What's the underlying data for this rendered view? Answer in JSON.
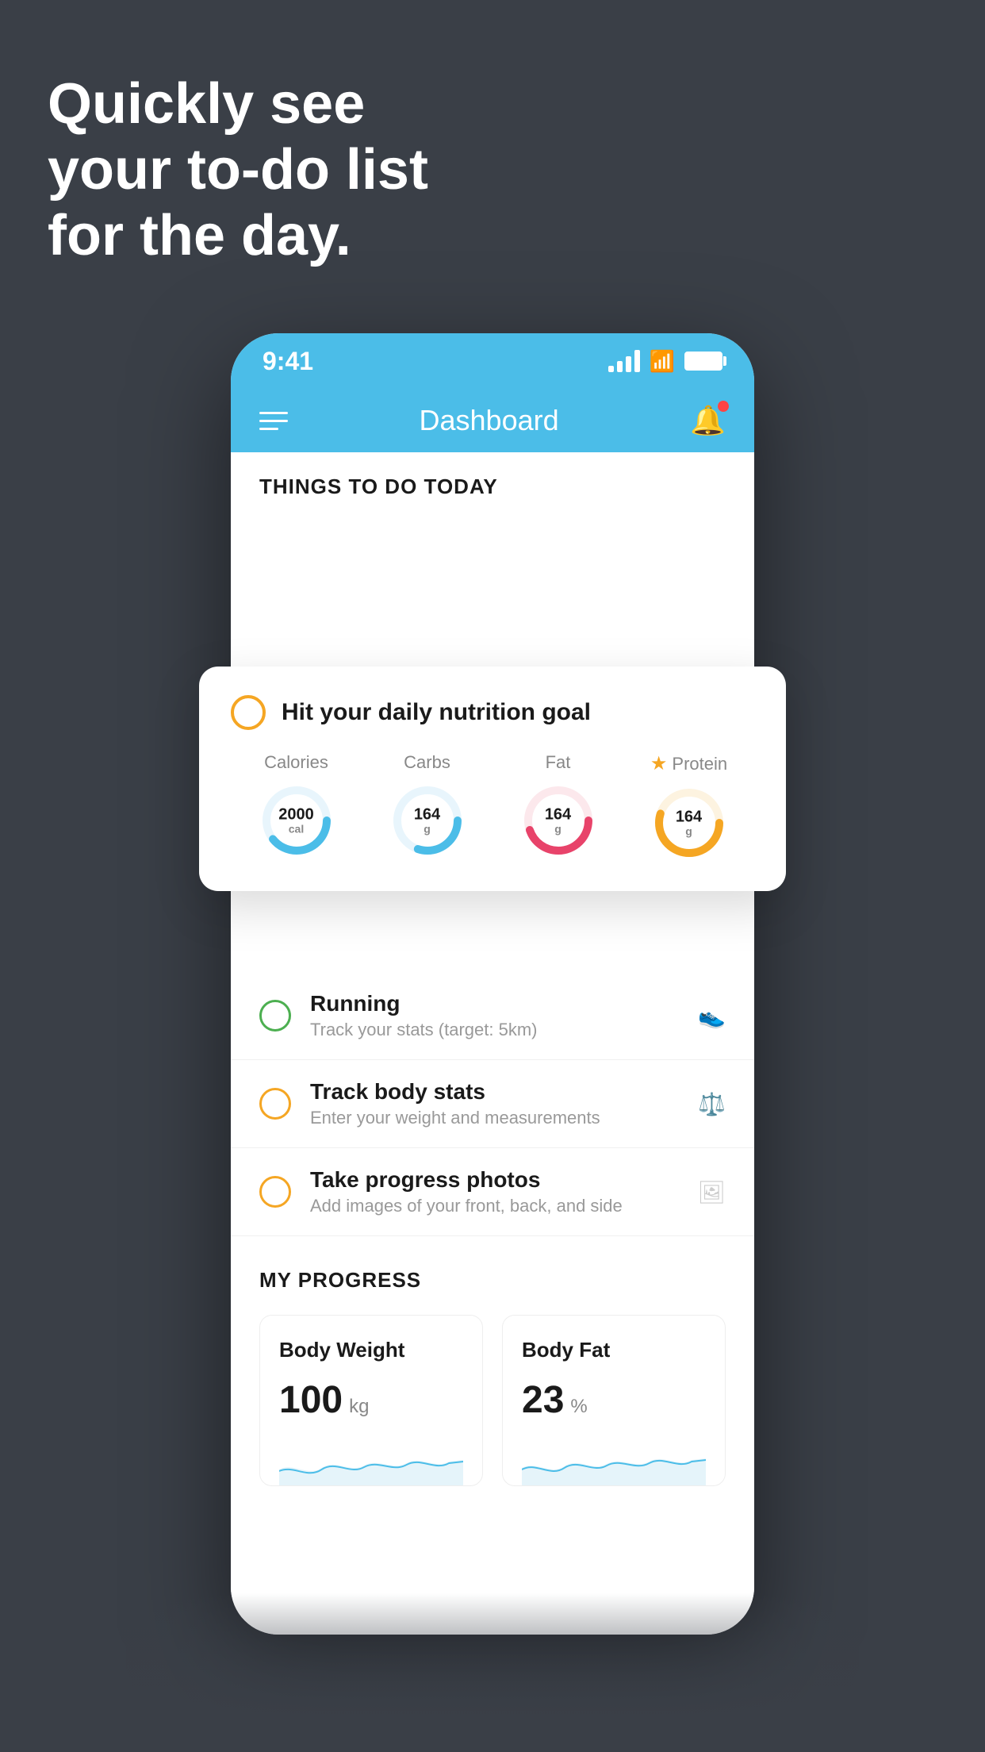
{
  "background": {
    "color": "#3a3f47"
  },
  "hero": {
    "line1": "Quickly see",
    "line2": "your to-do list",
    "line3": "for the day."
  },
  "phone": {
    "status_bar": {
      "time": "9:41",
      "signal_bars": 4,
      "wifi": true,
      "battery": true
    },
    "nav": {
      "title": "Dashboard",
      "menu_label": "menu",
      "bell_label": "notifications"
    },
    "things_today": {
      "section_title": "THINGS TO DO TODAY"
    },
    "nutrition_card": {
      "title": "Hit your daily nutrition goal",
      "items": [
        {
          "label": "Calories",
          "value": "2000",
          "unit": "cal",
          "color": "#4bbde8",
          "progress": 0.65
        },
        {
          "label": "Carbs",
          "value": "164",
          "unit": "g",
          "color": "#4bbde8",
          "progress": 0.55
        },
        {
          "label": "Fat",
          "value": "164",
          "unit": "g",
          "color": "#e8436a",
          "progress": 0.7
        },
        {
          "label": "Protein",
          "value": "164",
          "unit": "g",
          "color": "#f5a623",
          "progress": 0.8,
          "starred": true
        }
      ]
    },
    "todo_items": [
      {
        "title": "Running",
        "subtitle": "Track your stats (target: 5km)",
        "circle_color": "green",
        "icon": "shoe"
      },
      {
        "title": "Track body stats",
        "subtitle": "Enter your weight and measurements",
        "circle_color": "yellow",
        "icon": "scale"
      },
      {
        "title": "Take progress photos",
        "subtitle": "Add images of your front, back, and side",
        "circle_color": "yellow",
        "icon": "photo"
      }
    ],
    "progress": {
      "section_title": "MY PROGRESS",
      "cards": [
        {
          "title": "Body Weight",
          "value": "100",
          "unit": "kg"
        },
        {
          "title": "Body Fat",
          "value": "23",
          "unit": "%"
        }
      ]
    }
  }
}
